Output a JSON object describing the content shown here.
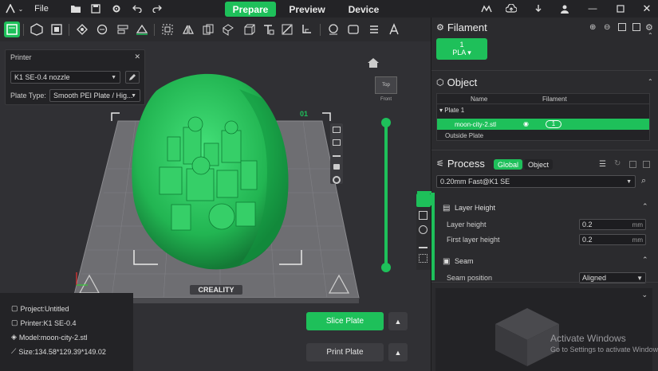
{
  "topbar": {
    "file_label": "File",
    "tabs": [
      {
        "label": "Prepare",
        "active": true
      },
      {
        "label": "Preview",
        "active": false
      },
      {
        "label": "Device",
        "active": false
      }
    ]
  },
  "toolbar": {
    "tools": [
      "slice-plate-icon",
      "add-icon",
      "plate-icon",
      "arrange-icon",
      "orient-icon",
      "layout-icon",
      "paint-icon",
      "scale-icon",
      "mirror-icon",
      "copy-icon",
      "support-icon",
      "cut-icon",
      "text-icon",
      "brush-icon",
      "seam-icon",
      "measure-icon",
      "assemble-icon",
      "list-icon",
      "text-tool-icon"
    ]
  },
  "printer_panel": {
    "title": "Printer",
    "printer": "K1 SE-0.4 nozzle",
    "plate_type_label": "Plate Type:",
    "plate_type": "Smooth PEI Plate / Hig..."
  },
  "viewport": {
    "plate_number": "01",
    "bed_brand": "CREALITY",
    "view_cube": {
      "top": "Top",
      "front": "Front"
    }
  },
  "filament": {
    "title": "Filament",
    "slot_number": "1",
    "slot_type": "PLA",
    "color": "#1ec05a"
  },
  "object": {
    "title": "Object",
    "columns": [
      "Name",
      "Filament"
    ],
    "rows": [
      {
        "name": "Plate 1",
        "filament": ""
      },
      {
        "name": "moon-city-2.stl",
        "filament": "1"
      },
      {
        "name": "Outside Plate",
        "filament": ""
      }
    ]
  },
  "process": {
    "title": "Process",
    "tab_global": "Global",
    "tab_object": "Object",
    "preset": "0.20mm Fast@K1 SE",
    "groups": [
      {
        "title": "Layer Height",
        "fields": [
          {
            "label": "Layer height",
            "value": "0.2",
            "unit": "mm"
          },
          {
            "label": "First layer height",
            "value": "0.2",
            "unit": "mm"
          }
        ]
      },
      {
        "title": "Seam",
        "fields": [
          {
            "label": "Seam position",
            "value": "Aligned",
            "unit": ""
          }
        ]
      }
    ]
  },
  "actions": {
    "slice": "Slice Plate",
    "print": "Print Plate"
  },
  "info": {
    "project": "Project:Untitled",
    "printer": "Printer:K1 SE-0.4",
    "model": "Model:moon-city-2.stl",
    "size": "Size:134.58*129.39*149.02"
  },
  "watermark": {
    "line1": "Activate Windows",
    "line2": "Go to Settings to activate Windows."
  }
}
